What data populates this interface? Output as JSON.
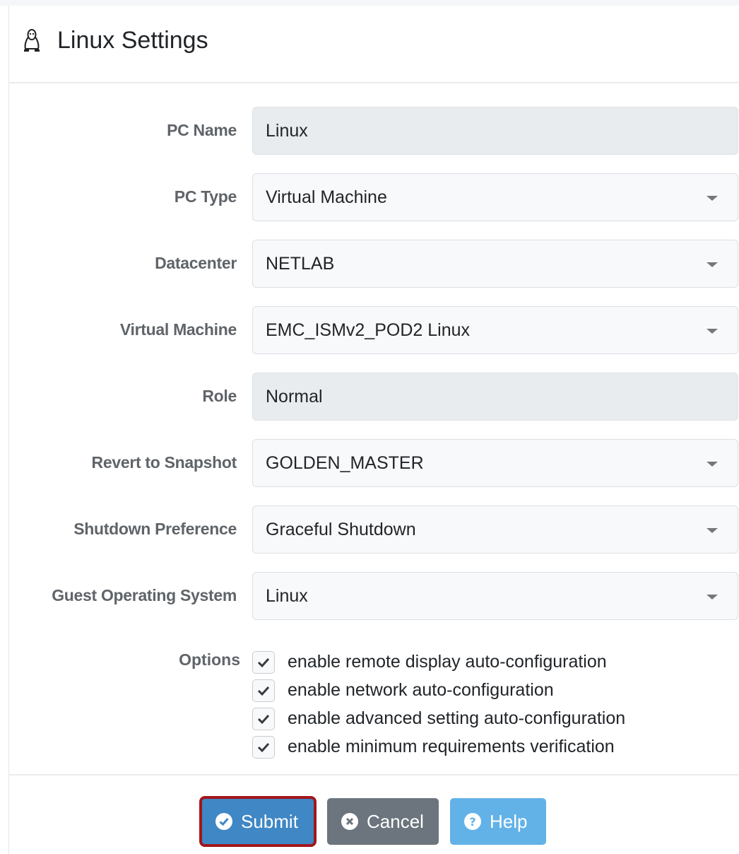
{
  "header": {
    "title": "Linux Settings",
    "icon": "linux-tux-icon"
  },
  "form": {
    "fields": [
      {
        "label": "PC Name",
        "value": "Linux",
        "type": "readonly"
      },
      {
        "label": "PC Type",
        "value": "Virtual Machine",
        "type": "select"
      },
      {
        "label": "Datacenter",
        "value": "NETLAB",
        "type": "select"
      },
      {
        "label": "Virtual Machine",
        "value": "EMC_ISMv2_POD2 Linux",
        "type": "select"
      },
      {
        "label": "Role",
        "value": "Normal",
        "type": "readonly"
      },
      {
        "label": "Revert to Snapshot",
        "value": "GOLDEN_MASTER",
        "type": "select"
      },
      {
        "label": "Shutdown Preference",
        "value": "Graceful Shutdown",
        "type": "select"
      },
      {
        "label": "Guest Operating System",
        "value": "Linux",
        "type": "select"
      }
    ],
    "options_label": "Options",
    "options": [
      {
        "label": "enable remote display auto-configuration",
        "checked": true
      },
      {
        "label": "enable network auto-configuration",
        "checked": true
      },
      {
        "label": "enable advanced setting auto-configuration",
        "checked": true
      },
      {
        "label": "enable minimum requirements verification",
        "checked": true
      }
    ]
  },
  "footer": {
    "submit_label": "Submit",
    "cancel_label": "Cancel",
    "help_label": "Help"
  },
  "colors": {
    "submit": "#3f87c5",
    "submit_outline": "#a1161c",
    "cancel": "#6c757d",
    "help": "#62b2e8"
  }
}
